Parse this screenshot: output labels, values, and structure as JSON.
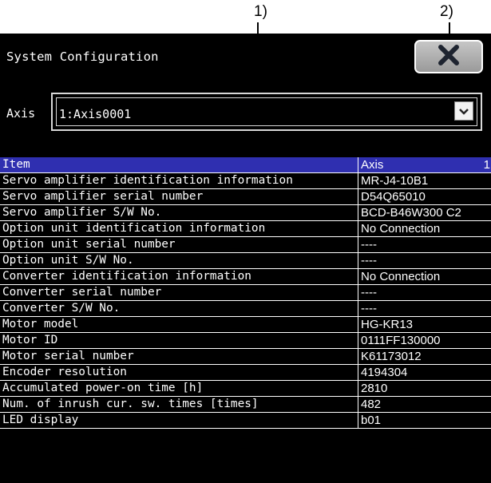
{
  "callouts": {
    "c1": "1)",
    "c2": "2)"
  },
  "window": {
    "title": "System Configuration",
    "close_icon": "close-x-icon"
  },
  "axis": {
    "label": "Axis",
    "value": "1:Axis0001",
    "dropdown_icon": "chevron-down-icon"
  },
  "table": {
    "columns": [
      "Item",
      "Axis",
      "1"
    ],
    "rows": [
      [
        "Servo amplifier identification information",
        "MR-J4-10B1"
      ],
      [
        "Servo amplifier serial number",
        "D54Q65010"
      ],
      [
        "Servo amplifier S/W No.",
        "BCD-B46W300 C2"
      ],
      [
        "Option unit identification information",
        "No Connection"
      ],
      [
        "Option unit serial number",
        "----"
      ],
      [
        "Option unit S/W No.",
        "----"
      ],
      [
        "Converter identification information",
        "No Connection"
      ],
      [
        "Converter serial number",
        "----"
      ],
      [
        "Converter S/W No.",
        "----"
      ],
      [
        "Motor model",
        "HG-KR13"
      ],
      [
        "Motor ID",
        "0111FF130000"
      ],
      [
        "Motor serial number",
        "K61173012"
      ],
      [
        "Encoder resolution",
        "4194304"
      ],
      [
        "Accumulated power-on time [h]",
        "2810"
      ],
      [
        "Num. of inrush cur. sw. times [times]",
        "482"
      ],
      [
        "LED display",
        "b01"
      ]
    ]
  },
  "colors": {
    "background": "#000000",
    "header_row": "#2f2fb0",
    "text": "#ffffff"
  }
}
